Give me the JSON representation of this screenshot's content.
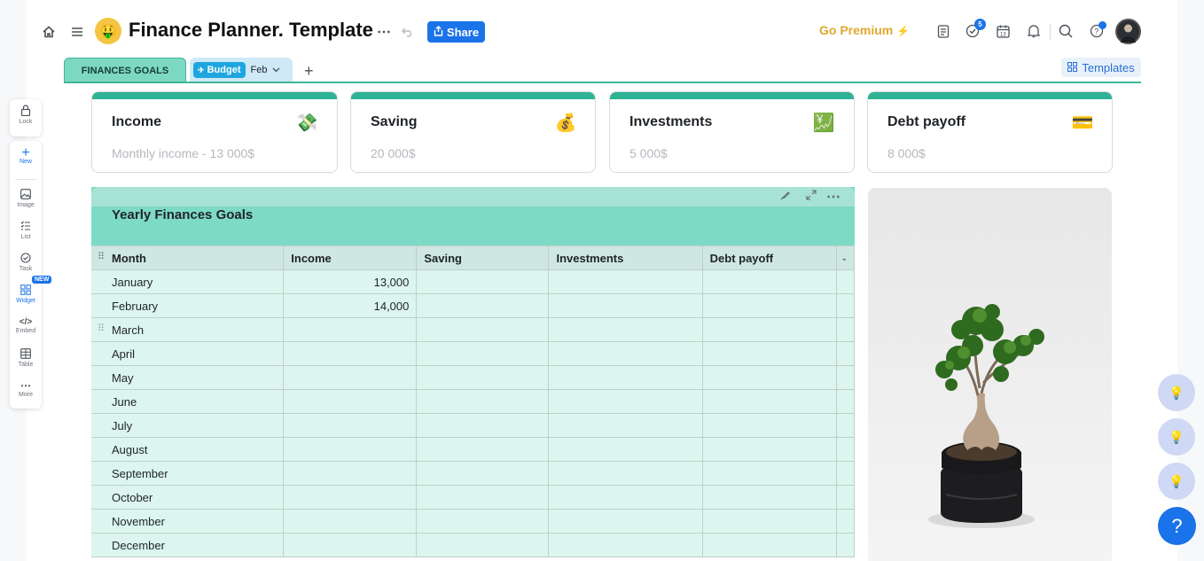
{
  "header": {
    "title_emoji": "🤑",
    "title": "Finance Planner. Template",
    "share_label": "Share",
    "premium_label": "Go Premium",
    "premium_bolt": "⚡",
    "notif_count": "5",
    "icons": [
      "home-icon",
      "menu-icon",
      "more-icon",
      "undo-icon",
      "share-icon",
      "notes-icon",
      "tasks-icon",
      "calendar-icon",
      "bell-icon",
      "search-icon",
      "help-icon",
      "avatar"
    ]
  },
  "tabs": {
    "goals": "FINANCES GOALS",
    "budget_chip": "Budget",
    "budget_month": "Feb",
    "add": "+",
    "templates": "Templates"
  },
  "left_toolbar": {
    "lock": "Lock",
    "new": "New",
    "image": "Image",
    "list": "List",
    "task": "Task",
    "widget": "Widget",
    "widget_badge": "NEW",
    "embed": "Embed",
    "table": "Table",
    "more": "More"
  },
  "cards": [
    {
      "title": "Income",
      "subtitle": "Monthly income - 13 000$",
      "emoji": "💸"
    },
    {
      "title": "Saving",
      "subtitle": "20 000$",
      "emoji": "💰"
    },
    {
      "title": "Investments",
      "subtitle": "5 000$",
      "emoji": "💹"
    },
    {
      "title": "Debt payoff",
      "subtitle": "8 000$",
      "emoji": "💳"
    }
  ],
  "table": {
    "title": "Yearly Finances Goals",
    "columns": [
      "Month",
      "Income",
      "Saving",
      "Investments",
      "Debt payoff",
      "-"
    ],
    "rows": [
      [
        "January",
        "13,000",
        "",
        "",
        "",
        ""
      ],
      [
        "February",
        "14,000",
        "",
        "",
        "",
        ""
      ],
      [
        "March",
        "",
        "",
        "",
        "",
        ""
      ],
      [
        "April",
        "",
        "",
        "",
        "",
        ""
      ],
      [
        "May",
        "",
        "",
        "",
        "",
        ""
      ],
      [
        "June",
        "",
        "",
        "",
        "",
        ""
      ],
      [
        "July",
        "",
        "",
        "",
        "",
        ""
      ],
      [
        "August",
        "",
        "",
        "",
        "",
        ""
      ],
      [
        "September",
        "",
        "",
        "",
        "",
        ""
      ],
      [
        "October",
        "",
        "",
        "",
        "",
        ""
      ],
      [
        "November",
        "",
        "",
        "",
        "",
        ""
      ],
      [
        "December",
        "",
        "",
        "",
        "",
        ""
      ]
    ]
  },
  "right_panel": {
    "help_label": "?"
  },
  "colors": {
    "accent": "#1a73e8",
    "teal": "#2fb394",
    "premium": "#e0a82e"
  }
}
